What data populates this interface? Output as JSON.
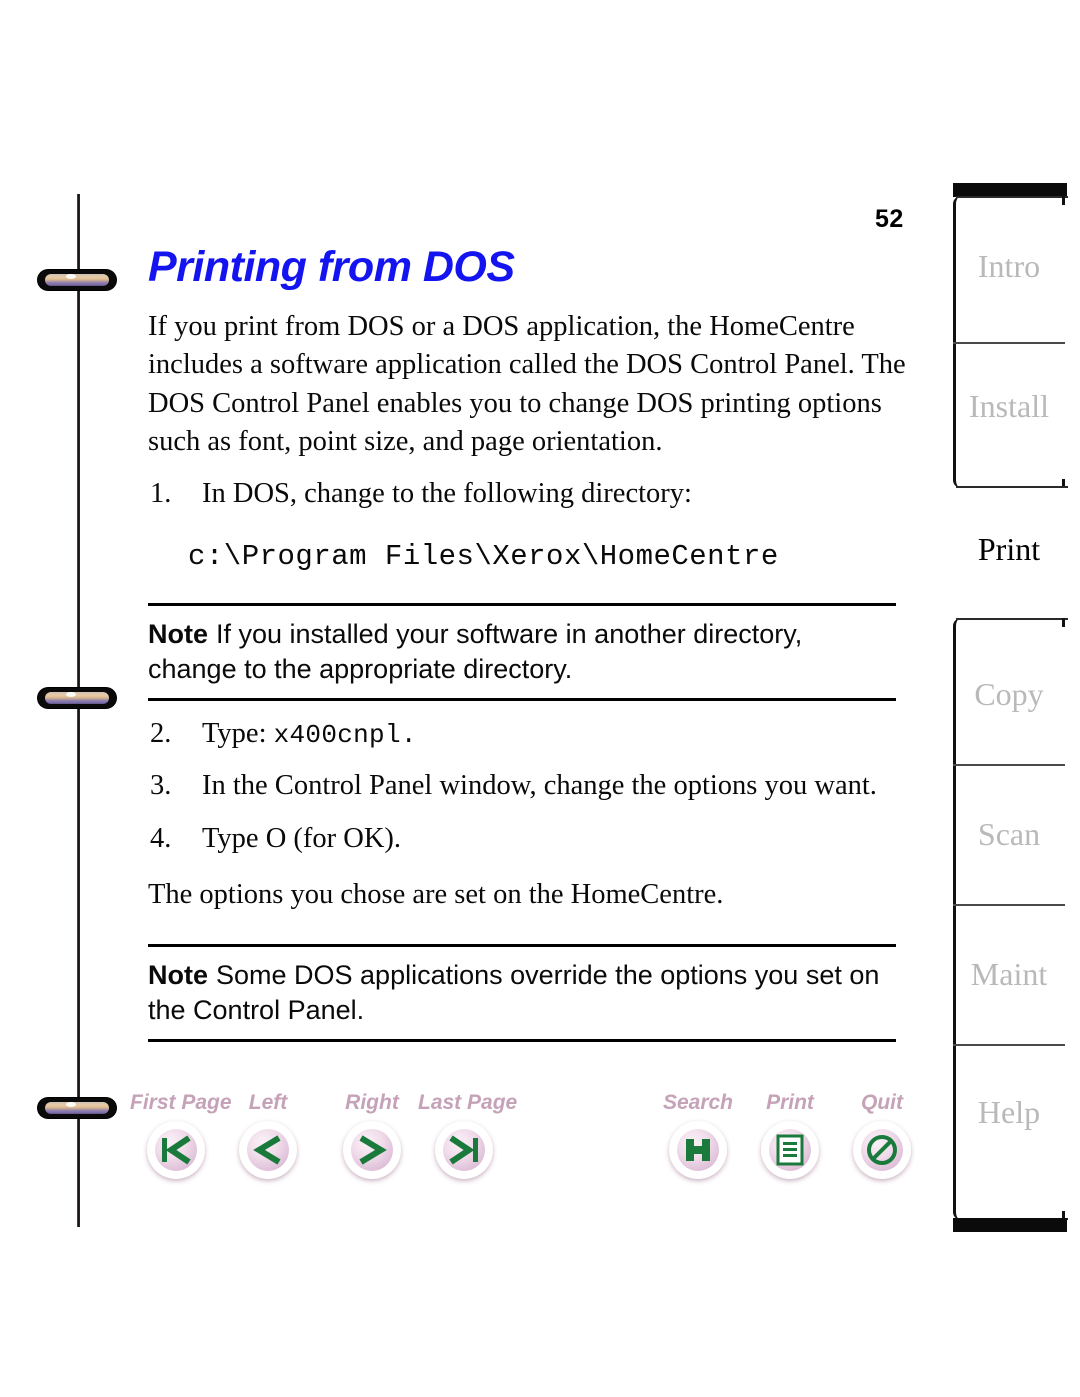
{
  "page": {
    "number": "52",
    "title": "Printing from DOS"
  },
  "body": {
    "intro": "If you print from DOS or a DOS application, the HomeCentre includes a software application called the DOS Control Panel. The DOS Control Panel enables you to change DOS printing options such as font, point size, and page orientation.",
    "closing": "The options you chose are set on the HomeCentre."
  },
  "steps": [
    {
      "num": "1.",
      "text": "In DOS, change to the following directory:",
      "mono": ""
    },
    {
      "num": "2.",
      "text": "Type: ",
      "mono": "x400cnpl."
    },
    {
      "num": "3.",
      "text": "In the Control Panel window, change the options you want.",
      "mono": ""
    },
    {
      "num": "4.",
      "text": "Type O (for OK).",
      "mono": ""
    }
  ],
  "code": {
    "path": "c:\\Program Files\\Xerox\\HomeCentre"
  },
  "notes": [
    {
      "lead": "Note",
      "text": "If you installed your software in another directory, change to the appropriate directory."
    },
    {
      "lead": "Note",
      "text": "Some DOS applications override the options you set on the Control Panel."
    }
  ],
  "toolbar": {
    "navigation": [
      {
        "label": "First Page",
        "icon": "first-page-icon"
      },
      {
        "label": "Left",
        "icon": "previous-page-icon"
      },
      {
        "label": "Right",
        "icon": "next-page-icon"
      },
      {
        "label": "Last Page",
        "icon": "last-page-icon"
      }
    ],
    "actions": [
      {
        "label": "Search",
        "icon": "search-icon"
      },
      {
        "label": "Print",
        "icon": "print-icon"
      },
      {
        "label": "Quit",
        "icon": "quit-icon"
      }
    ]
  },
  "side_tabs": [
    {
      "label": "Intro",
      "active": false
    },
    {
      "label": "Install",
      "active": false
    },
    {
      "label": "Print",
      "active": true
    },
    {
      "label": "Copy",
      "active": false
    },
    {
      "label": "Scan",
      "active": false
    },
    {
      "label": "Maint",
      "active": false
    },
    {
      "label": "Help",
      "active": false
    }
  ],
  "colors": {
    "title": "#1414f0",
    "tab_inactive": "#b9b9b9",
    "tab_active": "#000000",
    "tool_label": "#c5a2b8",
    "tool_glyph": "#1a7a3c"
  }
}
